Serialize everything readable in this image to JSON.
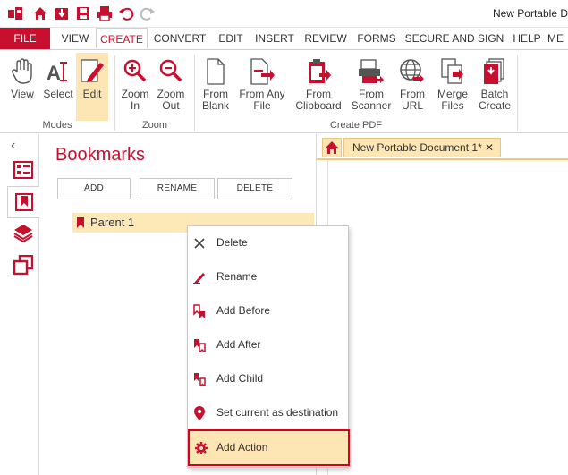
{
  "window": {
    "title": "New Portable D"
  },
  "quick_access": {
    "icons": [
      "app-logo-icon",
      "home-icon",
      "open-icon",
      "save-icon",
      "print-icon",
      "undo-icon",
      "redo-icon"
    ]
  },
  "tabs": {
    "file": "FILE",
    "items": [
      "VIEW",
      "CREATE",
      "CONVERT",
      "EDIT",
      "INSERT",
      "REVIEW",
      "FORMS",
      "SECURE AND SIGN",
      "HELP",
      "ME"
    ],
    "active": "CREATE"
  },
  "ribbon": {
    "modes": {
      "label": "Modes",
      "view": "View",
      "select": "Select",
      "edit": "Edit"
    },
    "zoom": {
      "label": "Zoom",
      "zoom_in": "Zoom\nIn",
      "zoom_out": "Zoom\nOut"
    },
    "create_pdf": {
      "label": "Create PDF",
      "from_blank": "From\nBlank",
      "from_any_file": "From Any\nFile",
      "from_clipboard": "From\nClipboard",
      "from_scanner": "From\nScanner",
      "from_url": "From\nURL",
      "merge_files": "Merge\nFiles",
      "batch_create": "Batch\nCreate"
    }
  },
  "rail": {
    "collapse": "‹"
  },
  "bookmarks": {
    "title": "Bookmarks",
    "add": "ADD",
    "rename": "RENAME",
    "delete": "DELETE",
    "items": [
      {
        "label": "Parent 1"
      }
    ]
  },
  "document": {
    "tab_label": "New Portable Document 1*",
    "close": "✕"
  },
  "context_menu": {
    "items": [
      {
        "label": "Delete"
      },
      {
        "label": "Rename"
      },
      {
        "label": "Add Before"
      },
      {
        "label": "Add After"
      },
      {
        "label": "Add Child"
      },
      {
        "label": "Set current as destination"
      },
      {
        "label": "Add Action"
      }
    ],
    "highlighted": "Add Action"
  },
  "colors": {
    "accent": "#c8102e",
    "selection": "#fde6b3",
    "highlight_border": "#d8001c"
  }
}
